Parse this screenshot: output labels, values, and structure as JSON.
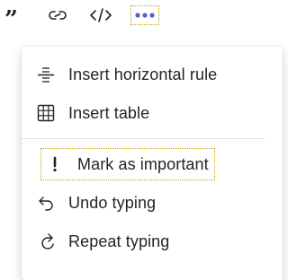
{
  "toolbar": {
    "quote_icon": "quote-icon",
    "link_icon": "link-icon",
    "code_icon": "code-icon",
    "more_icon": "more-options-icon",
    "accent_color": "#5b5fc7"
  },
  "menu": {
    "items": [
      {
        "label": "Insert horizontal rule",
        "icon": "horizontal-rule-icon"
      },
      {
        "label": "Insert table",
        "icon": "table-icon"
      },
      {
        "label": "Mark as important",
        "icon": "exclamation-icon"
      },
      {
        "label": "Undo typing",
        "icon": "undo-icon"
      },
      {
        "label": "Repeat typing",
        "icon": "redo-icon"
      }
    ]
  }
}
